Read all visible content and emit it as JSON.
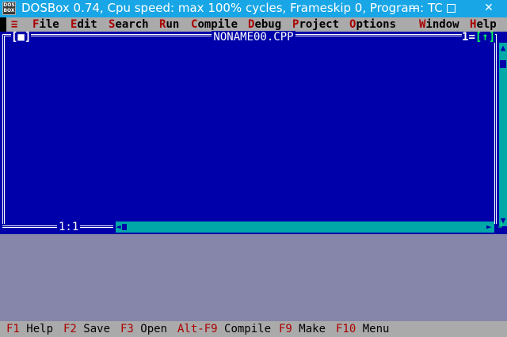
{
  "window": {
    "icon_text": "DOS BOX",
    "title": "DOSBox 0.74, Cpu speed: max 100% cycles, Frameskip  0, Program:    TC",
    "close_glyph": "✕"
  },
  "menubar": {
    "system_menu": "≡",
    "items": [
      {
        "hot": "F",
        "rest": "ile"
      },
      {
        "hot": "E",
        "rest": "dit"
      },
      {
        "hot": "S",
        "rest": "earch"
      },
      {
        "hot": "R",
        "rest": "un"
      },
      {
        "hot": "C",
        "rest": "ompile"
      },
      {
        "hot": "D",
        "rest": "ebug"
      },
      {
        "hot": "P",
        "rest": "roject"
      },
      {
        "hot": "O",
        "rest": "ptions"
      },
      {
        "hot": "W",
        "rest": "indow"
      },
      {
        "hot": "H",
        "rest": "elp"
      }
    ]
  },
  "editor": {
    "close_box": "[■]",
    "file_name": "NONAME00.CPP",
    "window_number": "1",
    "zoom_box": "[↑]",
    "cursor_position": "1:1",
    "scroll_up": "▲",
    "scroll_down": "▼",
    "scroll_left": "◄",
    "scroll_right": "►",
    "resize_corner": "┘"
  },
  "statusbar": {
    "keys": [
      {
        "key": "F1",
        "label": "Help"
      },
      {
        "key": "F2",
        "label": "Save"
      },
      {
        "key": "F3",
        "label": "Open"
      },
      {
        "key": "Alt-F9",
        "label": "Compile"
      },
      {
        "key": "F9",
        "label": "Make"
      },
      {
        "key": "F10",
        "label": "Menu"
      }
    ]
  },
  "colors": {
    "titlebar": "#18a6e6",
    "editor_bg": "#0000aa",
    "menu_bg": "#aaaaaa",
    "hotkey": "#aa0000",
    "scrollbar": "#00a8a8",
    "accent": "#00ff55"
  }
}
